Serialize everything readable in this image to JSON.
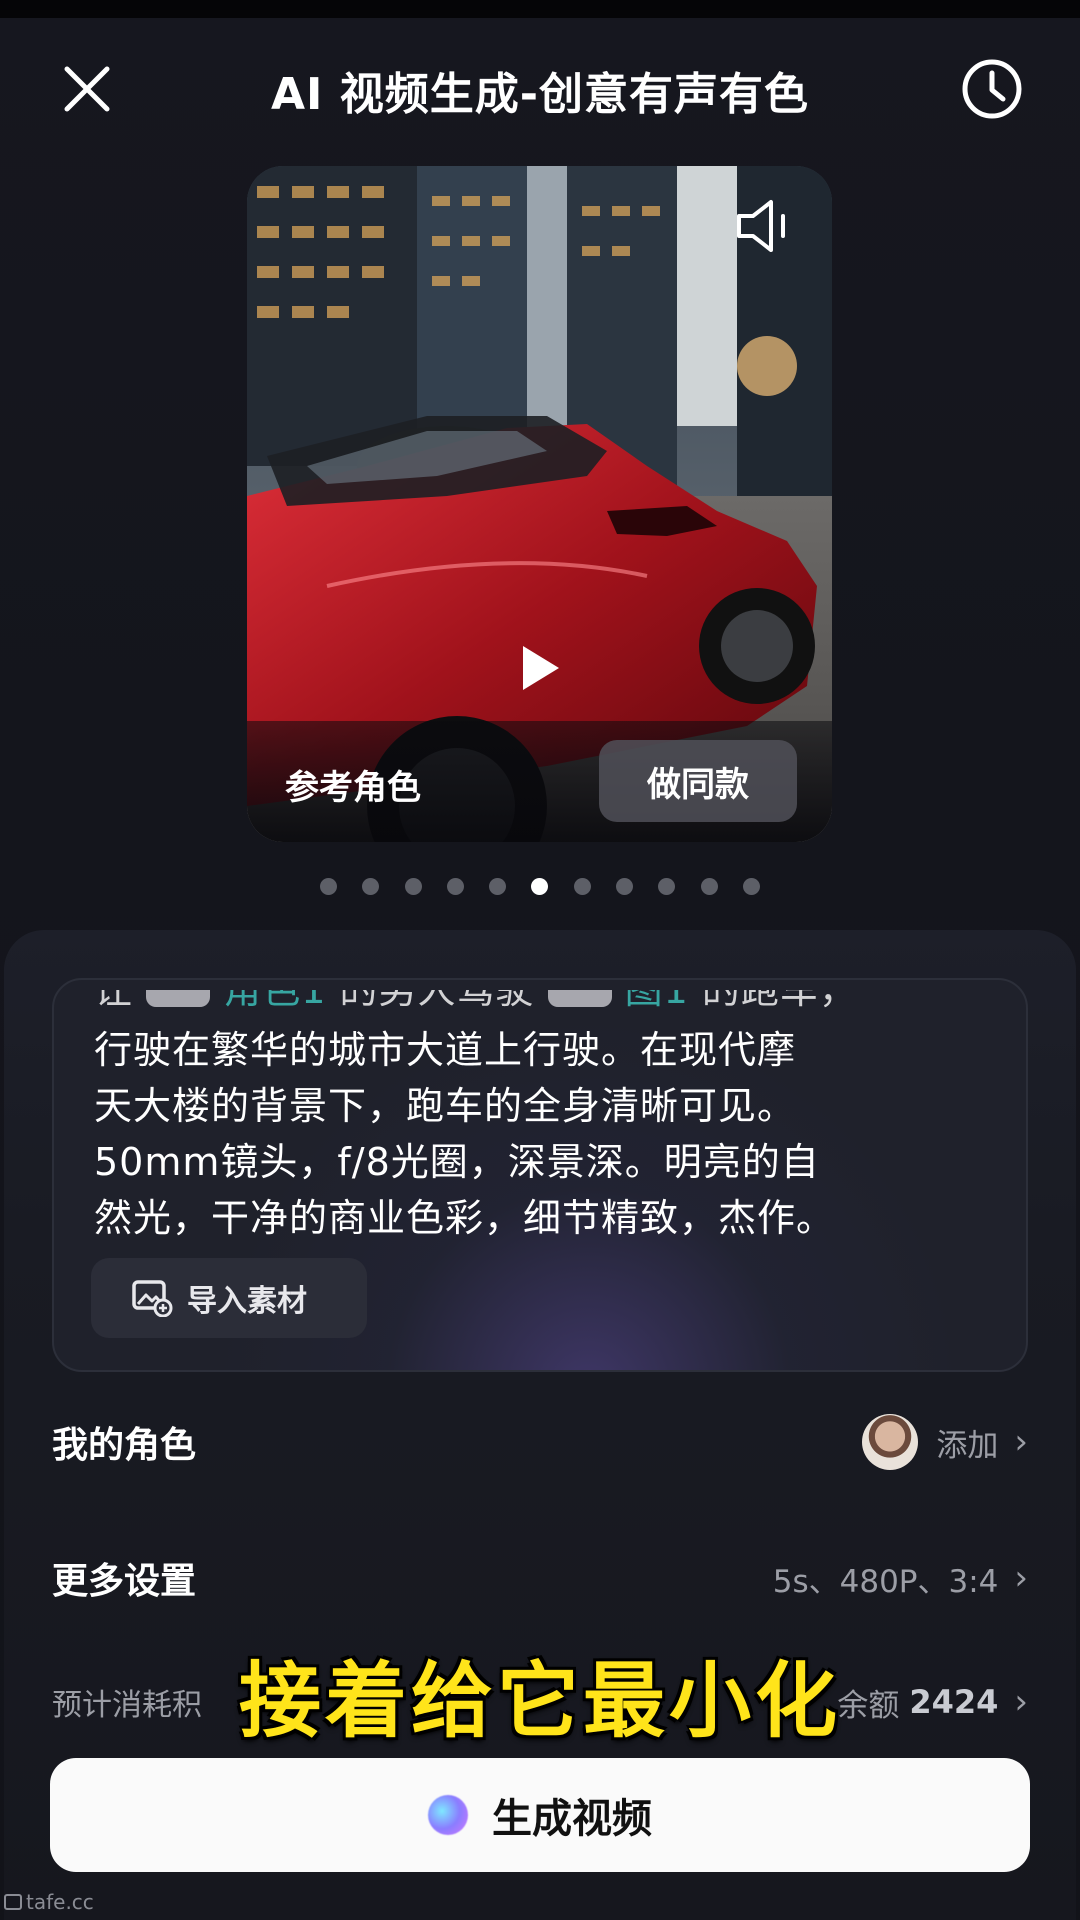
{
  "header": {
    "title": "AI 视频生成-创意有声有色",
    "close_icon": "close-icon",
    "history_icon": "clock-icon"
  },
  "preview": {
    "reference_label": "参考角色",
    "make_same_label": "做同款",
    "speaker_icon": "speaker-icon",
    "play_icon": "play-icon",
    "carousel_total": 11,
    "carousel_active": 6
  },
  "prompt": {
    "lines": [
      "行驶在繁华的城市大道上行驶。在现代摩",
      "天大楼的背景下，跑车的全身清晰可见。",
      "50mm镜头，f/8光圈，深景深。明亮的自",
      "然光，干净的商业色彩，细节精致，杰作。"
    ],
    "import_label": "导入素材",
    "import_icon": "image-add-icon"
  },
  "my_role": {
    "label": "我的角色",
    "action": "添加"
  },
  "more_settings": {
    "label": "更多设置",
    "value": "5s、480P、3:4"
  },
  "cost": {
    "label": "预计消耗积",
    "value_prefix": "余额",
    "value": "2424"
  },
  "subtitle": "接着给它最小化",
  "generate": {
    "label": "生成视频"
  },
  "watermark": "tafe.cc",
  "colors": {
    "accent_teal": "#3ec8c0",
    "subtitle_yellow": "#ffe41a",
    "car_red": "#b0141c"
  }
}
